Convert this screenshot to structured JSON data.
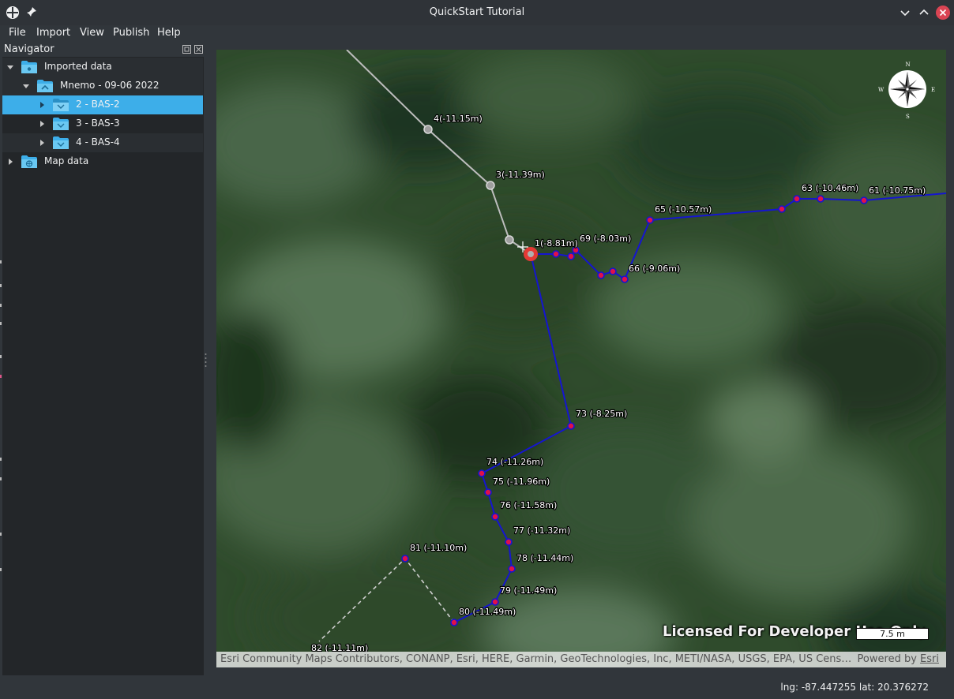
{
  "window": {
    "title": "QuickStart Tutorial",
    "icons": [
      "app-logo-icon",
      "pin-icon",
      "minimize-icon",
      "maximize-icon",
      "close-icon"
    ]
  },
  "menu": {
    "file": "File",
    "import": "Import",
    "view": "View",
    "publish": "Publish",
    "help": "Help"
  },
  "navigator": {
    "title": "Navigator",
    "items": [
      {
        "label": "Imported data",
        "level": 0,
        "expanded": true,
        "icon": "folder-icon"
      },
      {
        "label": "Mnemo - 09-06 2022",
        "level": 1,
        "expanded": true,
        "icon": "folder-icon"
      },
      {
        "label": "2 - BAS-2",
        "level": 2,
        "expanded": false,
        "selected": true,
        "icon": "folder-icon"
      },
      {
        "label": "3 - BAS-3",
        "level": 2,
        "expanded": false,
        "icon": "folder-icon"
      },
      {
        "label": "4 - BAS-4",
        "level": 2,
        "expanded": false,
        "icon": "folder-icon"
      },
      {
        "label": "Map data",
        "level": 0,
        "expanded": false,
        "icon": "globe-folder-icon"
      }
    ]
  },
  "map": {
    "station_labels": {
      "s4": "4(-11.15m)",
      "s3": "3(-11.39m)",
      "s1": "1(-8.81m)",
      "s69": "69 (-8.03m)",
      "s66": "66 (-9.06m)",
      "s65": "65 (-10.57m)",
      "s63": "63 (-10.46m)",
      "s61": "61 (-10.75m)",
      "s73": "73 (-8.25m)",
      "s74": "74 (-11.26m)",
      "s75": "75 (-11.96m)",
      "s76": "76 (-11.58m)",
      "s77": "77 (-11.32m)",
      "s78": "78 (-11.44m)",
      "s79": "79 (-11.49m)",
      "s80": "80 (-11.49m)",
      "s81": "81 (-11.10m)",
      "s82": "82 (-11.11m)"
    },
    "compass": {
      "n": "N",
      "s": "S",
      "e": "E",
      "w": "W"
    },
    "license_text": "Licensed For Developer Use Only",
    "scale": "7.5 m",
    "attribution": "Esri Community Maps Contributors, CONANP, Esri, HERE, Garmin, GeoTechnologies, Inc, METI/NASA, USGS, EPA, US Cens…",
    "powered_by": "Powered by",
    "esri_link": "Esri",
    "colors": {
      "survey_line": "#1515d0",
      "station_fill": "#e0104a",
      "inactive_line": "#bdbdbd",
      "selected": "#e53935"
    }
  },
  "status": {
    "coords": "lng: -87.447255 lat: 20.376272"
  }
}
